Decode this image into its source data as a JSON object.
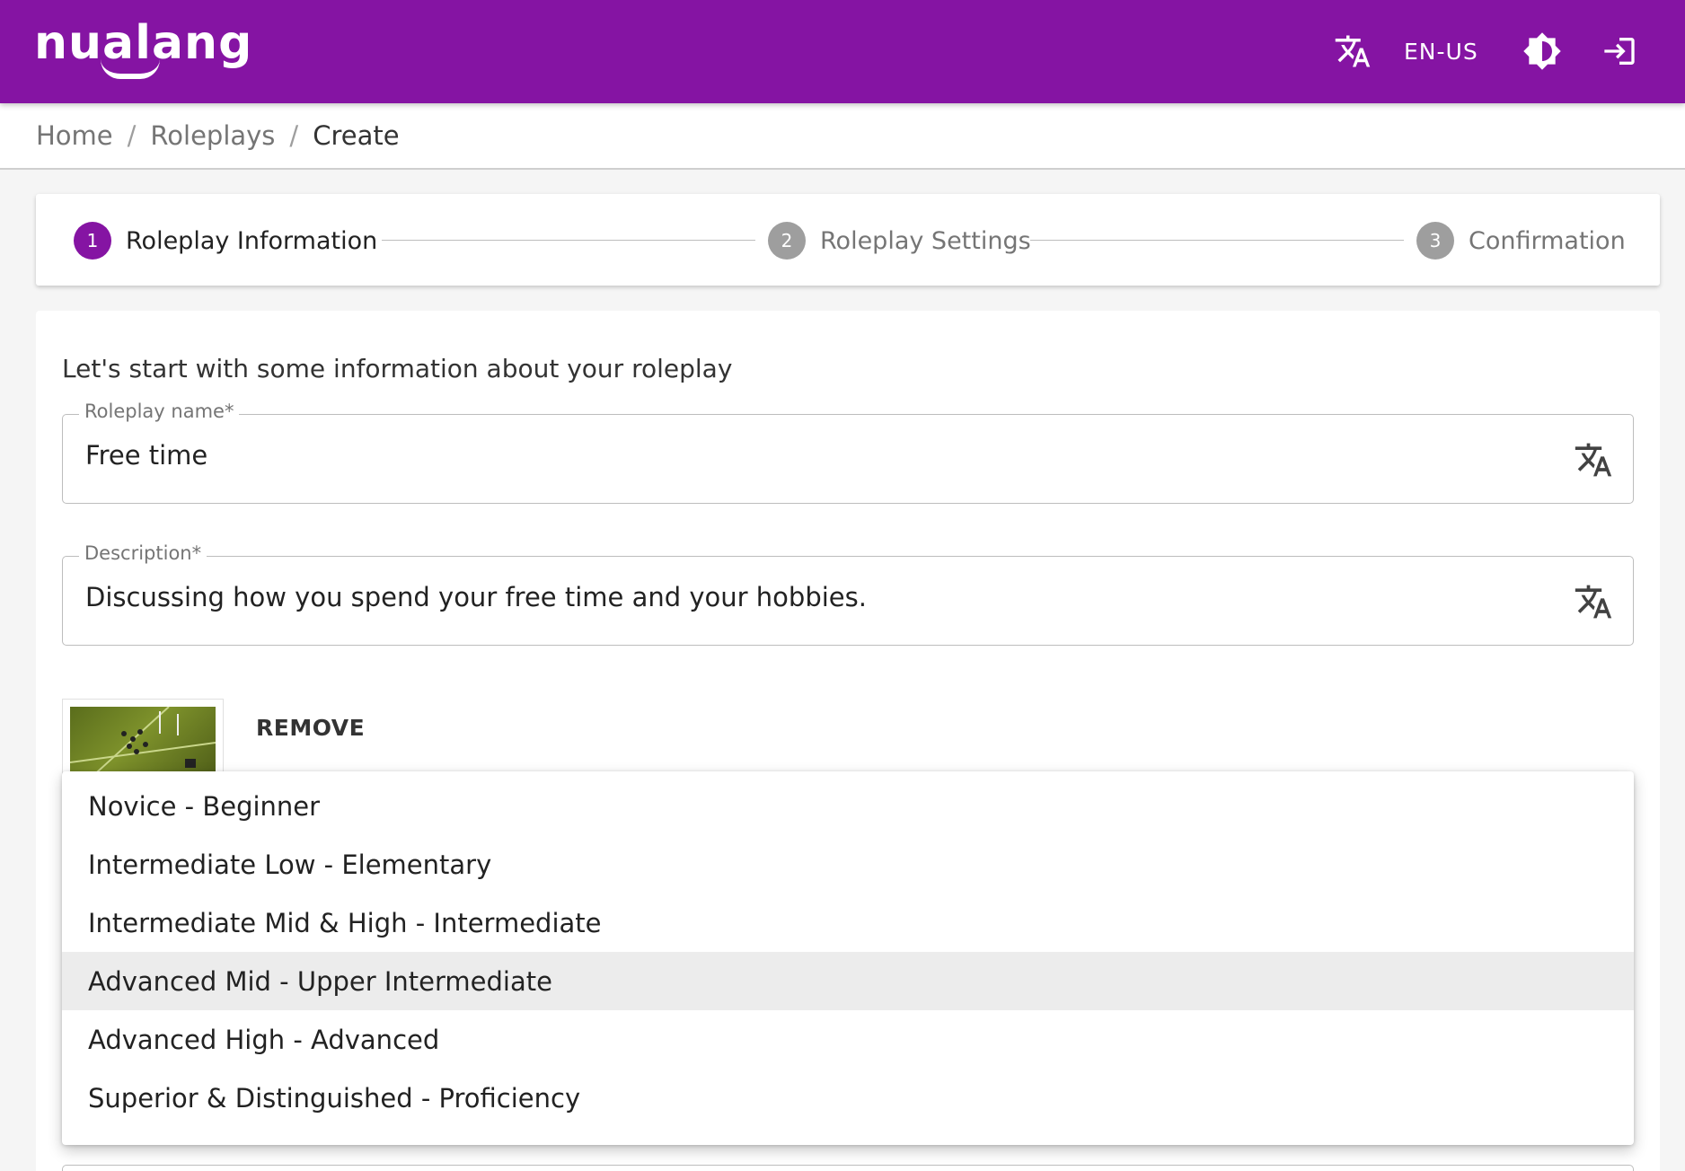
{
  "app": {
    "logo_text": "nualang",
    "brand_color": "#8514a3",
    "locale": "EN-US"
  },
  "header": {
    "icons": [
      "translate-icon",
      "brightness-icon",
      "login-icon"
    ]
  },
  "breadcrumb": {
    "items": [
      "Home",
      "Roleplays",
      "Create"
    ],
    "separator": "/"
  },
  "stepper": {
    "steps": [
      {
        "number": "1",
        "label": "Roleplay Information",
        "active": true
      },
      {
        "number": "2",
        "label": "Roleplay Settings",
        "active": false
      },
      {
        "number": "3",
        "label": "Confirmation",
        "active": false
      }
    ]
  },
  "form": {
    "intro": "Let's start with some information about your roleplay",
    "name_label": "Roleplay name*",
    "name_value": "Free time",
    "description_label": "Description*",
    "description_value": "Discussing how you spend your free time and your hobbies.",
    "remove_label": "REMOVE"
  },
  "level_menu": {
    "options": [
      "Novice - Beginner",
      "Intermediate Low - Elementary",
      "Intermediate Mid & High - Intermediate",
      "Advanced Mid - Upper Intermediate",
      "Advanced High - Advanced",
      "Superior & Distinguished - Proficiency"
    ],
    "hovered_index": 3
  }
}
